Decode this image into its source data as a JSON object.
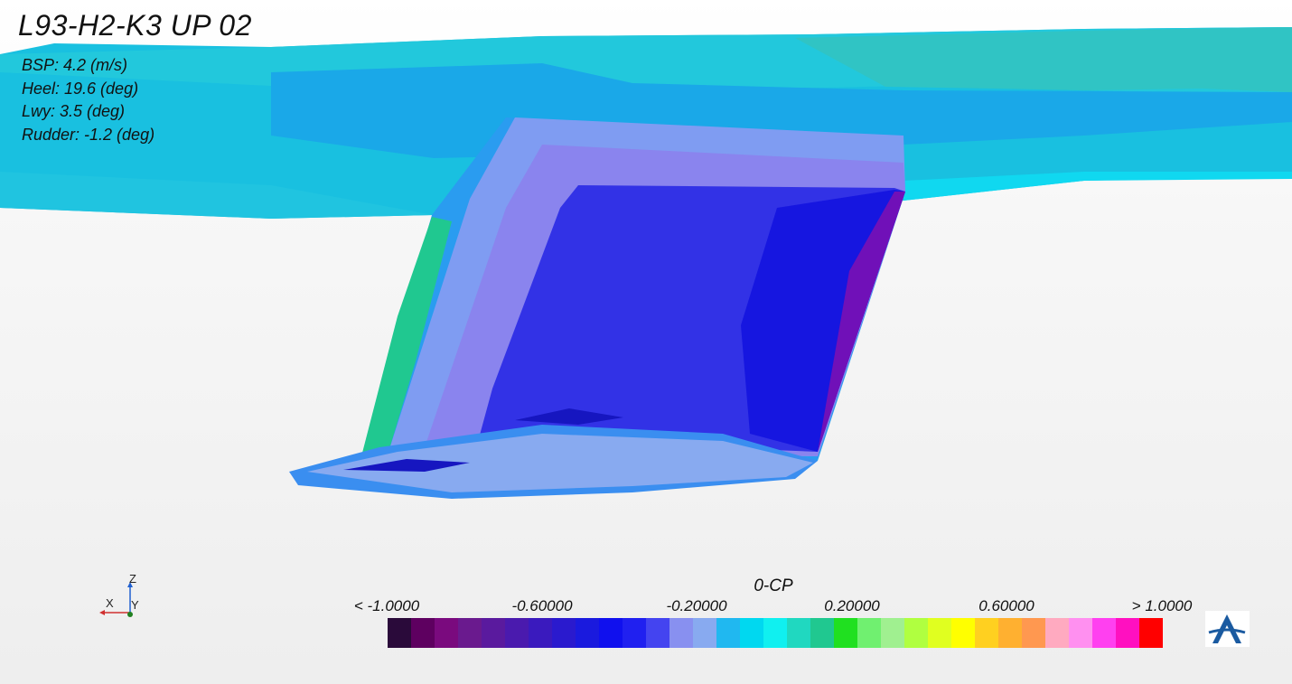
{
  "title": "L93-H2-K3 UP 02",
  "info": [
    "BSP: 4.2 (m/s)",
    "Heel: 19.6 (deg)",
    "Lwy: 3.5 (deg)",
    "Rudder: -1.2 (deg)"
  ],
  "colorbar": {
    "title": "0-CP",
    "ticks": [
      "< -1.0000",
      "-0.60000",
      "-0.20000",
      "0.20000",
      "0.60000",
      "> 1.0000"
    ],
    "colors": [
      "#2a0a3a",
      "#5e0060",
      "#7a0a7e",
      "#6a1a8e",
      "#5a1a9e",
      "#4a1aae",
      "#3a1abe",
      "#2a1ace",
      "#1a1ade",
      "#1010ee",
      "#2020f0",
      "#4444f0",
      "#8890f0",
      "#88aaf0",
      "#20b8f0",
      "#00d8f0",
      "#10f0f0",
      "#20d8c0",
      "#20c890",
      "#20e020",
      "#70f070",
      "#a0f090",
      "#b0ff40",
      "#e0ff20",
      "#ffff00",
      "#ffd020",
      "#ffb030",
      "#ff9850",
      "#ffaac0",
      "#ff90f0",
      "#ff40f0",
      "#ff10c0",
      "#ff0000"
    ],
    "range": [
      -1.0,
      1.0
    ]
  },
  "axes_triad": {
    "z": "Z",
    "x": "X",
    "y": "Y"
  },
  "logo": "logo-icon"
}
